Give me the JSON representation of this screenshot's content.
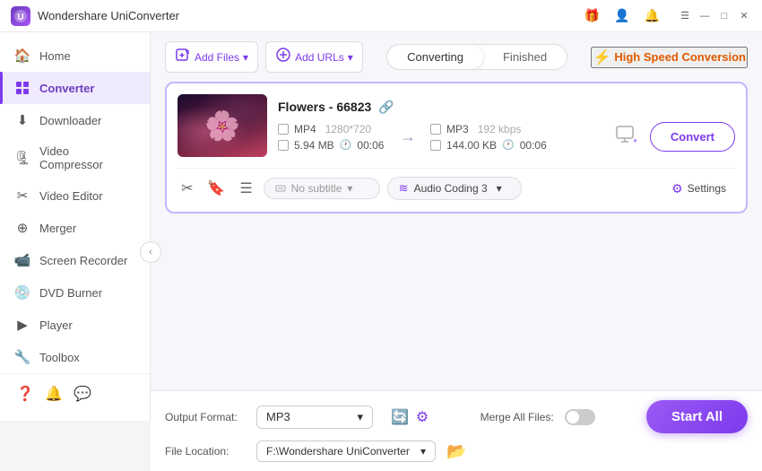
{
  "app": {
    "title": "Wondershare UniConverter",
    "icon": "W"
  },
  "titlebar": {
    "controls": [
      "gift-icon",
      "user-icon",
      "bell-icon",
      "menu-icon",
      "minimize-icon",
      "maximize-icon",
      "close-icon"
    ]
  },
  "sidebar": {
    "items": [
      {
        "id": "home",
        "label": "Home",
        "icon": "🏠",
        "active": false
      },
      {
        "id": "converter",
        "label": "Converter",
        "icon": "⊟",
        "active": true
      },
      {
        "id": "downloader",
        "label": "Downloader",
        "icon": "⬇",
        "active": false
      },
      {
        "id": "video-compressor",
        "label": "Video Compressor",
        "icon": "🗜",
        "active": false
      },
      {
        "id": "video-editor",
        "label": "Video Editor",
        "icon": "✂",
        "active": false
      },
      {
        "id": "merger",
        "label": "Merger",
        "icon": "⊕",
        "active": false
      },
      {
        "id": "screen-recorder",
        "label": "Screen Recorder",
        "icon": "📹",
        "active": false
      },
      {
        "id": "dvd-burner",
        "label": "DVD Burner",
        "icon": "💿",
        "active": false
      },
      {
        "id": "player",
        "label": "Player",
        "icon": "▶",
        "active": false
      },
      {
        "id": "toolbox",
        "label": "Toolbox",
        "icon": "🔧",
        "active": false
      }
    ],
    "bottom_icons": [
      "help-icon",
      "bell-icon",
      "feedback-icon"
    ]
  },
  "toolbar": {
    "add_file_label": "Add Files",
    "add_url_label": "Add URLs",
    "tabs": [
      {
        "id": "converting",
        "label": "Converting",
        "active": true
      },
      {
        "id": "finished",
        "label": "Finished",
        "active": false
      }
    ],
    "high_speed_label": "High Speed Conversion"
  },
  "file_card": {
    "name": "Flowers - 66823",
    "source": {
      "format": "MP4",
      "resolution": "1280*720",
      "size": "5.94 MB",
      "duration": "00:06"
    },
    "target": {
      "format": "MP3",
      "bitrate": "192 kbps",
      "size": "144.00 KB",
      "duration": "00:06"
    },
    "subtitle_placeholder": "No subtitle",
    "audio_coding_label": "Audio Coding 3",
    "settings_label": "Settings",
    "convert_btn_label": "Convert"
  },
  "bottom_bar": {
    "output_format_label": "Output Format:",
    "output_format_value": "MP3",
    "format_icons": [
      "refresh-icon",
      "settings-icon"
    ],
    "merge_label": "Merge All Files:",
    "file_location_label": "File Location:",
    "file_location_value": "F:\\Wondershare UniConverter",
    "start_all_label": "Start All"
  }
}
